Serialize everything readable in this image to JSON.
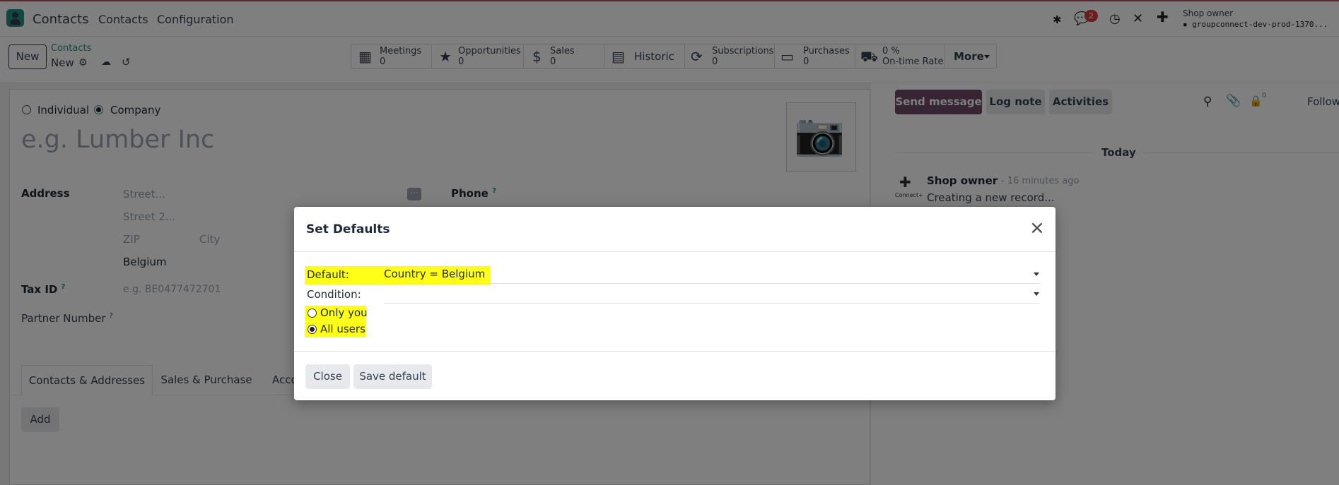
{
  "navbar": {
    "app_name": "Contacts",
    "menu_contacts": "Contacts",
    "menu_configuration": "Configuration",
    "messages_badge": "2",
    "user_name": "Shop owner",
    "database": "groupconnect-dev-prod-1370..."
  },
  "control": {
    "new_button": "New",
    "breadcrumb_parent": "Contacts",
    "breadcrumb_current": "New",
    "stats": [
      {
        "label": "Meetings",
        "value": "0"
      },
      {
        "label": "Opportunities",
        "value": "0"
      },
      {
        "label": "Sales",
        "value": "0"
      },
      {
        "label": "Historic",
        "value": ""
      },
      {
        "label": "Subscriptions",
        "value": "0"
      },
      {
        "label": "Purchases",
        "value": "0"
      },
      {
        "label": "0 %",
        "value": "On-time Rate"
      }
    ],
    "more_button": "More"
  },
  "form": {
    "type_individual": "Individual",
    "type_company": "Company",
    "name_placeholder": "e.g. Lumber Inc",
    "address_label": "Address",
    "street_placeholder": "Street...",
    "street2_placeholder": "Street 2...",
    "zip_placeholder": "ZIP",
    "city_placeholder": "City",
    "country_value": "Belgium",
    "phone_label": "Phone",
    "help_mark": "?",
    "tax_id_label": "Tax ID",
    "tax_id_placeholder": "e.g. BE0477472701",
    "partner_number_label": "Partner Number",
    "tabs": [
      "Contacts & Addresses",
      "Sales & Purchase",
      "Acco"
    ],
    "add_button": "Add"
  },
  "chatter": {
    "send_message": "Send message",
    "log_note": "Log note",
    "activities": "Activities",
    "followers_count": "0",
    "follow": "Follow",
    "date_separator": "Today",
    "message_author": "Shop owner",
    "message_time": "- 16 minutes ago",
    "message_body": "Creating a new record...",
    "avatar_caption": "Connect+"
  },
  "dialog": {
    "title": "Set Defaults",
    "default_label": "Default:",
    "default_value": "Country = Belgium",
    "condition_label": "Condition:",
    "option_only_you": "Only you",
    "option_all_users": "All users",
    "selected_option": "All users",
    "close_button": "Close",
    "save_button": "Save default"
  },
  "colors": {
    "highlight": "#ffff17",
    "brand_purple": "#714b67",
    "accent_teal": "#1f8f84",
    "badge_red": "#d23f3a"
  }
}
